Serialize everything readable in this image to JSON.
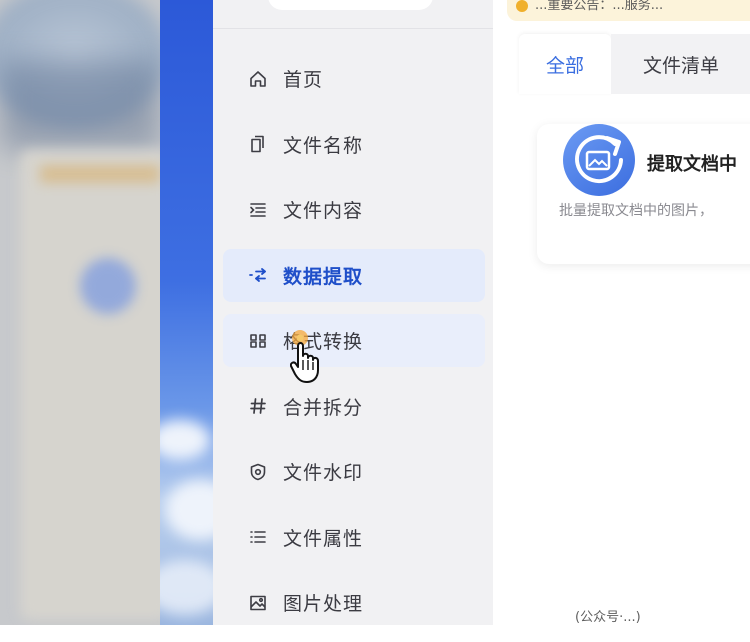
{
  "sidebar": {
    "items": [
      {
        "label": "首页",
        "icon": "home-icon"
      },
      {
        "label": "文件名称",
        "icon": "file-copy-icon"
      },
      {
        "label": "文件内容",
        "icon": "indent-list-icon"
      },
      {
        "label": "数据提取",
        "icon": "extract-arrows-icon",
        "active": true
      },
      {
        "label": "格式转换",
        "icon": "convert-frame-icon",
        "hover": true
      },
      {
        "label": "合并拆分",
        "icon": "hash-icon"
      },
      {
        "label": "文件水印",
        "icon": "shield-icon"
      },
      {
        "label": "文件属性",
        "icon": "list-icon"
      },
      {
        "label": "图片处理",
        "icon": "image-icon"
      }
    ]
  },
  "notice": {
    "text": "...重要公告：...服务..."
  },
  "tabs": [
    {
      "label": "全部",
      "active": true
    },
    {
      "label": "文件清单",
      "active": false
    }
  ],
  "card": {
    "title": "提取文档中",
    "description": "批量提取文档中的图片，"
  },
  "watermark": {
    "text": "(公众号·...)"
  },
  "colors": {
    "accent": "#1f4fc9",
    "tab_active_text": "#3a6ee0",
    "active_item_bg": "#e4ebfb",
    "sidebar_bg": "#f1f1f3"
  }
}
